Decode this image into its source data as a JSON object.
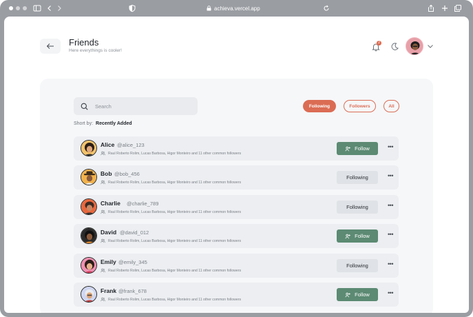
{
  "browser": {
    "url": "achieva.vercel.app"
  },
  "header": {
    "title": "Friends",
    "subtitle": "Here everythings is cooler!",
    "notification_count": "2"
  },
  "search": {
    "placeholder": "Search"
  },
  "tabs": [
    {
      "label": "Following"
    },
    {
      "label": "Followers"
    },
    {
      "label": "All"
    }
  ],
  "sort": {
    "label": "Short by:",
    "value": "Recently Added"
  },
  "friends": [
    {
      "name": "Alice",
      "handle": "@alice_123",
      "mutual": "Raul Roberto Rolim, Lucas Barbosa, Higor Monteiro and 11 other common followers",
      "button": "Follow",
      "avatar_color": "#f3c36b"
    },
    {
      "name": "Bob",
      "handle": "@bob_456",
      "mutual": "Raul Roberto Rolim, Lucas Barbosa, Higor Monteiro and 11 other common followers",
      "button": "Following",
      "avatar_color": "#f1b24c"
    },
    {
      "name": "Charlie",
      "handle": "@charlie_789",
      "mutual": "Raul Roberto Rolim, Lucas Barbosa, Higor Monteiro and 11 other common followers",
      "button": "Following",
      "avatar_color": "#e8673d"
    },
    {
      "name": "David",
      "handle": "@david_012",
      "mutual": "Raul Roberto Rolim, Lucas Barbosa, Higor Monteiro and 11 other common followers",
      "button": "Follow",
      "avatar_color": "#2b2b2b"
    },
    {
      "name": "Emily",
      "handle": "@emily_345",
      "mutual": "Raul Roberto Rolim, Lucas Barbosa, Higor Monteiro and 11 other common followers",
      "button": "Following",
      "avatar_color": "#f08fb0"
    },
    {
      "name": "Frank",
      "handle": "@frank_678",
      "mutual": "Raul Roberto Rolim, Lucas Barbosa, Higor Monteiro and 11 other common followers",
      "button": "Follow",
      "avatar_color": "#cfd6f0"
    }
  ],
  "icons": {
    "back": "arrow-left-icon",
    "bell": "bell-icon",
    "theme": "moon-icon",
    "dropdown": "chevron-down-icon",
    "search": "search-icon",
    "more": "more-horizontal-icon",
    "follow": "user-plus-icon",
    "mutual": "users-icon"
  },
  "colors": {
    "accent": "#db6c54",
    "follow_button": "#5c8a73",
    "following_button": "#dfe2e6",
    "panel_bg": "#f6f7f9",
    "row_bg": "#eceef1"
  }
}
